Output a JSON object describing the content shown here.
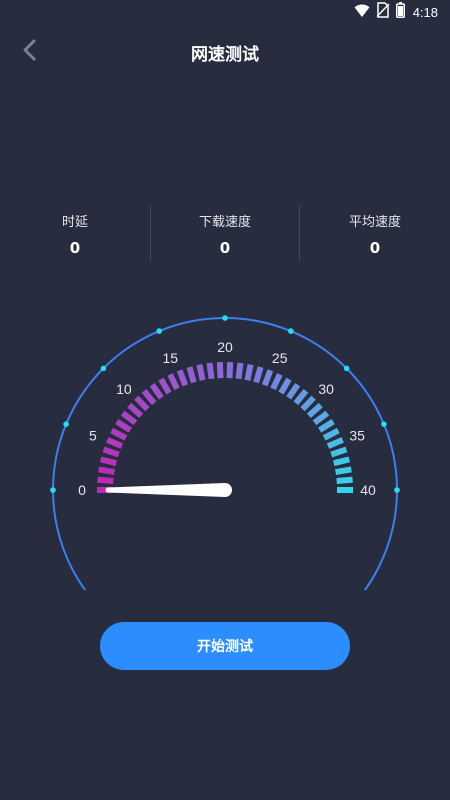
{
  "status_bar": {
    "time": "4:18",
    "icons": [
      "wifi-icon",
      "no-sim-icon",
      "battery-icon"
    ]
  },
  "header": {
    "title": "网速测试",
    "back_icon": "chevron-left-icon"
  },
  "stats": [
    {
      "label": "时延",
      "value": "0"
    },
    {
      "label": "下载速度",
      "value": "0"
    },
    {
      "label": "平均速度",
      "value": "0"
    }
  ],
  "gauge": {
    "min": 0,
    "max": 40,
    "current": 0,
    "ticks": [
      "0",
      "5",
      "10",
      "15",
      "20",
      "25",
      "30",
      "35",
      "40"
    ],
    "colors": {
      "start": "#c026b8",
      "mid": "#8a6bd6",
      "end": "#33d6ea",
      "outer_arc": "#3b7ff0",
      "dot": "#22e0f0",
      "needle": "#ffffff"
    }
  },
  "start_button": {
    "label": "开始测试",
    "color": "#2c8dff"
  }
}
